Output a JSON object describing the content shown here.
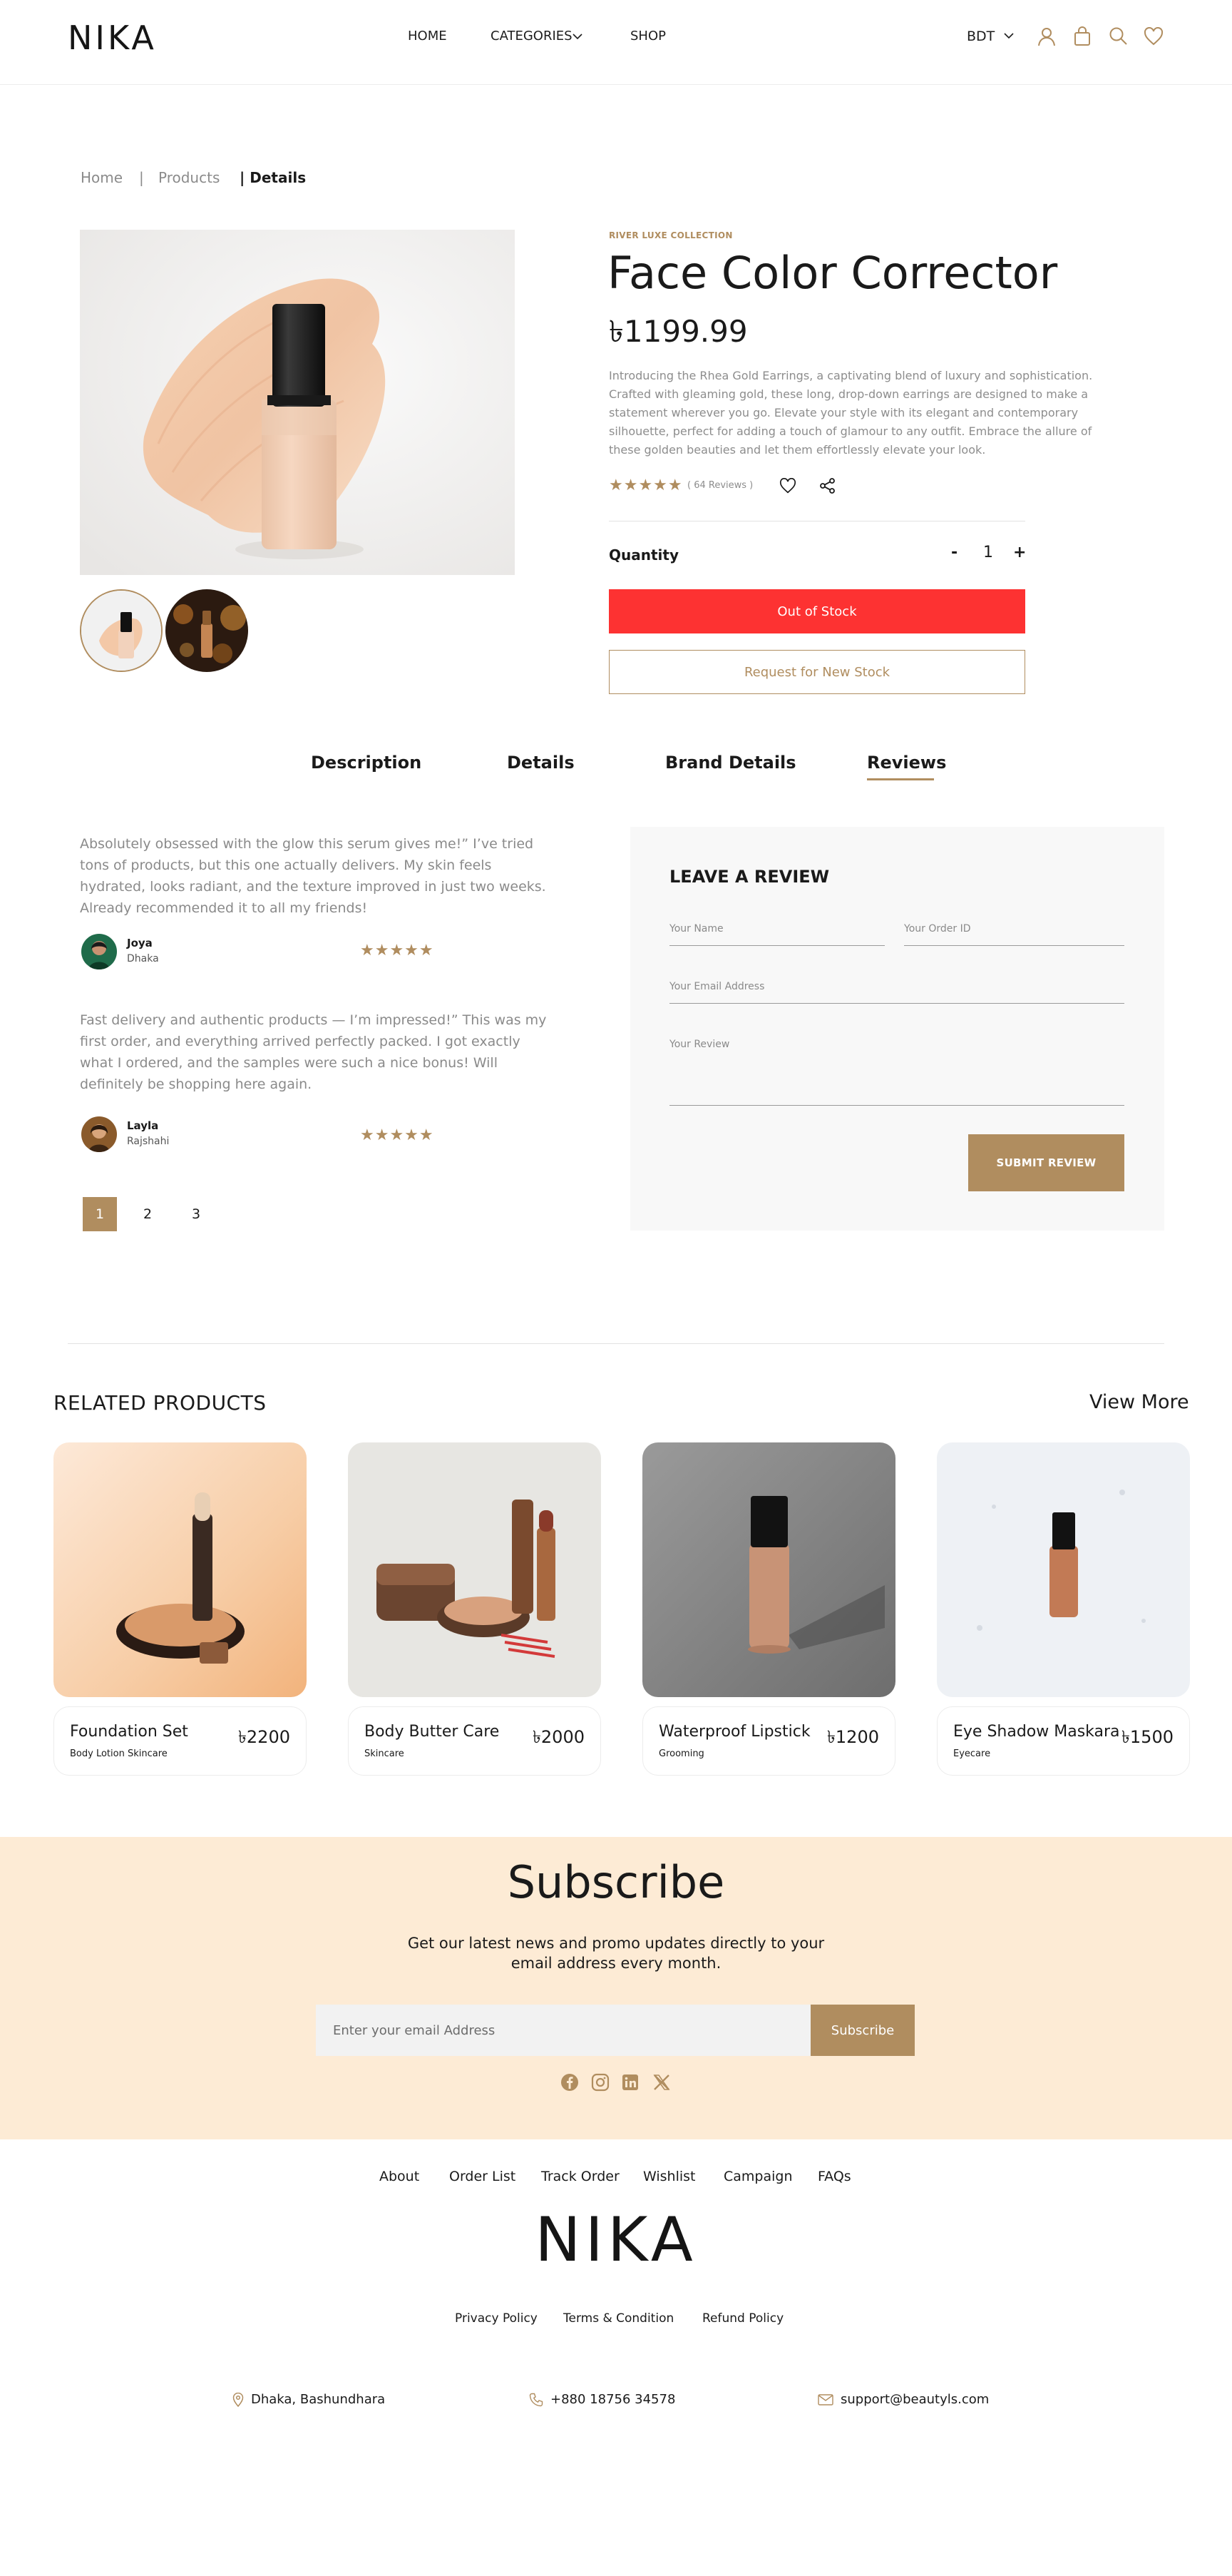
{
  "header": {
    "logo": "NIKA",
    "nav": {
      "home": "HOME",
      "categories": "CATEGORIES",
      "shop": "SHOP"
    },
    "currency": "BDT"
  },
  "breadcrumb": {
    "home": "Home",
    "sep": "|",
    "products": "Products",
    "details": "| Details"
  },
  "product": {
    "collection": "RIVER LUXE COLLECTION",
    "title": "Face Color Corrector",
    "price": "৳1199.99",
    "description": "Introducing the Rhea Gold Earrings, a captivating blend of luxury and sophistication. Crafted with gleaming gold, these long, drop-down earrings are designed to make a statement wherever you go. Elevate your style with its elegant and contemporary silhouette, perfect for adding a touch of glamour to any outfit. Embrace the allure of these golden beauties and let them effortlessly elevate your look.",
    "stars": "★★★★★",
    "reviews_count": "( 64 Reviews )",
    "quantity_label": "Quantity",
    "quantity_minus": "-",
    "quantity_value": "1",
    "quantity_plus": "+",
    "out_of_stock": "Out of Stock",
    "request_stock": "Request for New Stock"
  },
  "tabs": {
    "description": "Description",
    "details": "Details",
    "brand": "Brand Details",
    "reviews": "Reviews"
  },
  "reviews": [
    {
      "text": "Absolutely obsessed with the glow this serum gives me!” I’ve tried tons of products, but this one actually delivers. My skin feels hydrated, looks radiant, and the texture improved in just two weeks. Already recommended it to all my friends!",
      "name": "Joya",
      "location": "Dhaka",
      "stars": "★★★★★"
    },
    {
      "text": "Fast delivery and authentic products — I’m impressed!” This was my first order, and everything arrived perfectly packed. I got exactly what I ordered, and the samples were such a nice bonus! Will definitely be shopping here again.",
      "name": "Layla",
      "location": "Rajshahi",
      "stars": "★★★★★"
    }
  ],
  "pagination": [
    "1",
    "2",
    "3"
  ],
  "review_form": {
    "title": "LEAVE A REVIEW",
    "name_placeholder": "Your Name",
    "order_placeholder": "Your Order ID",
    "email_placeholder": "Your Email Address",
    "review_placeholder": "Your Review",
    "submit": "SUBMIT REVIEW"
  },
  "related": {
    "title": "RELATED PRODUCTS",
    "view_more": "View More",
    "items": [
      {
        "name": "Foundation Set",
        "category": "Body Lotion Skincare",
        "price": "৳2200"
      },
      {
        "name": "Body Butter Care",
        "category": "Skincare",
        "price": "৳2000"
      },
      {
        "name": "Waterproof Lipstick",
        "category": "Grooming",
        "price": "৳1200"
      },
      {
        "name": "Eye Shadow Maskara",
        "category": "Eyecare",
        "price": "৳1500"
      }
    ]
  },
  "subscribe": {
    "title": "Subscribe",
    "text": "Get our latest news and promo updates directly to your email address every month.",
    "placeholder": "Enter your email Address",
    "button": "Subscribe"
  },
  "footer": {
    "links": [
      "About",
      "Order List",
      "Track Order",
      "Wishlist",
      "Campaign",
      "FAQs"
    ],
    "logo": "NIKA",
    "legal": [
      "Privacy Policy",
      "Terms & Condition",
      "Refund Policy"
    ],
    "location": "Dhaka, Bashundhara",
    "phone": "+880 18756 34578",
    "email": "support@beautyls.com"
  },
  "colors": {
    "accent": "#b08d5f",
    "danger": "#fd3232",
    "subscribe_bg": "#fdebd5"
  },
  "icons": [
    "user-icon",
    "bag-icon",
    "search-icon",
    "heart-icon",
    "share-icon",
    "chevron-down-icon",
    "facebook-icon",
    "instagram-icon",
    "linkedin-icon",
    "x-icon",
    "location-icon",
    "phone-icon",
    "mail-icon"
  ]
}
